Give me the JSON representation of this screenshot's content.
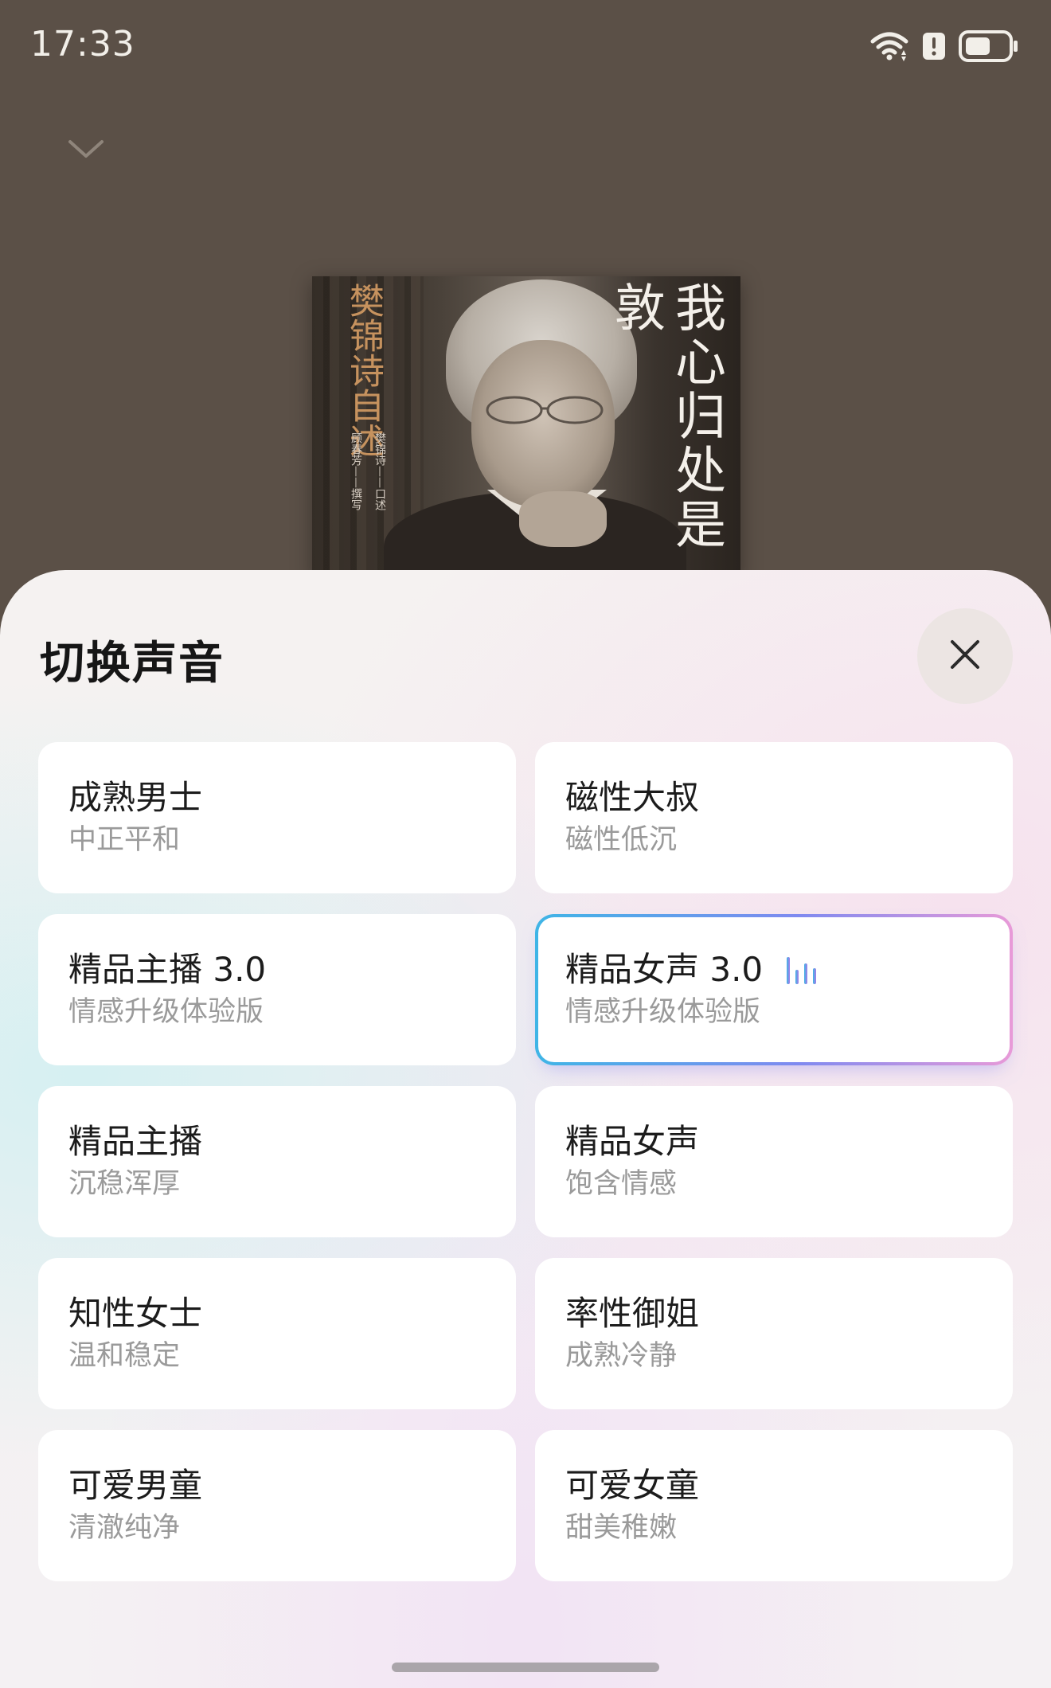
{
  "status_bar": {
    "time": "17:33"
  },
  "book": {
    "title": "我心归处是敦",
    "author": "樊锦诗自述",
    "credit_left": "樊锦诗——口述",
    "credit_right": "顾春芳——撰写"
  },
  "sheet": {
    "title": "切换声音",
    "selected_voice": "精品女声 3.0",
    "voices": [
      {
        "name": "成熟男士",
        "desc": "中正平和"
      },
      {
        "name": "磁性大叔",
        "desc": "磁性低沉"
      },
      {
        "name": "精品主播 3.0",
        "desc": "情感升级体验版"
      },
      {
        "name": "精品女声 3.0",
        "desc": "情感升级体验版"
      },
      {
        "name": "精品主播",
        "desc": "沉稳浑厚"
      },
      {
        "name": "精品女声",
        "desc": "饱含情感"
      },
      {
        "name": "知性女士",
        "desc": "温和稳定"
      },
      {
        "name": "率性御姐",
        "desc": "成熟冷静"
      },
      {
        "name": "可爱男童",
        "desc": "清澈纯净"
      },
      {
        "name": "可爱女童",
        "desc": "甜美稚嫩"
      }
    ]
  },
  "icons": {
    "wifi": "wifi-icon",
    "alert": "alert-icon",
    "battery": "battery-icon",
    "collapse": "chevron-down-icon",
    "close": "close-icon",
    "playing": "audio-bars-icon"
  },
  "colors": {
    "sheet_accent_start": "#3fb5e6",
    "sheet_accent_end": "#e89ad8"
  }
}
